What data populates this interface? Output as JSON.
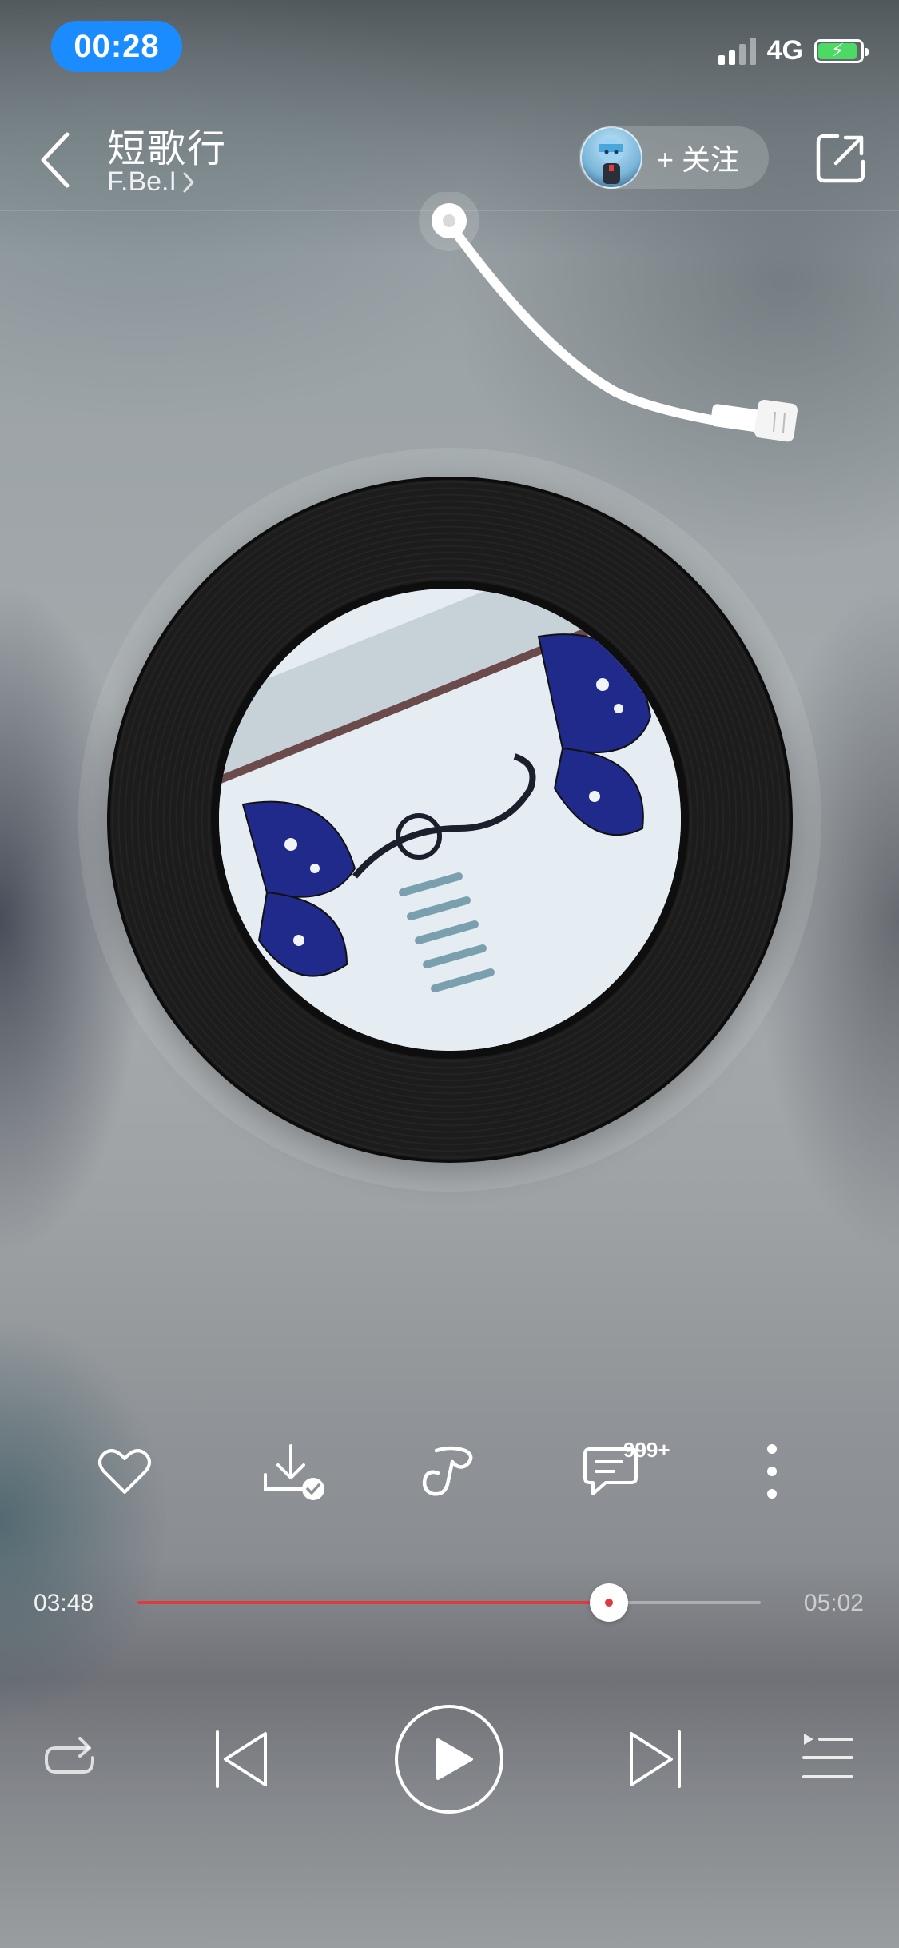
{
  "status_bar": {
    "time": "00:28",
    "network": "4G"
  },
  "header": {
    "title": "短歌行",
    "artist": "F.Be.I",
    "follow_label": "+ 关注"
  },
  "actions": {
    "items": [
      "heart-icon",
      "download-done-icon",
      "sing-icon",
      "comment-icon",
      "more-icon"
    ],
    "comment_badge": "999+"
  },
  "progress": {
    "current": "03:48",
    "total": "05:02",
    "fraction": 0.757
  },
  "controls": {
    "items": [
      "repeat-icon",
      "previous-icon",
      "play-icon",
      "next-icon",
      "playlist-icon"
    ]
  },
  "colors": {
    "accent": "#e0393e",
    "time_pill": "#1a8cff",
    "battery": "#4cd964"
  }
}
